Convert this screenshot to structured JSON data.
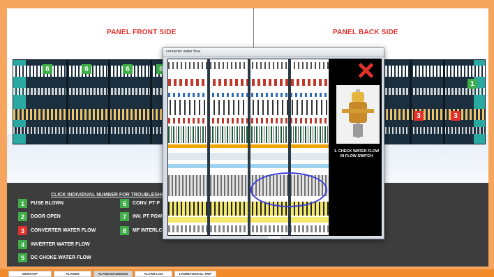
{
  "panel": {
    "front_title": "PANEL FRONT SIDE",
    "back_title": "PANEL BACK SIDE",
    "front_tags": [
      "6",
      "6",
      "6",
      "6"
    ],
    "back_tags_green": [
      "1"
    ],
    "back_tags_red": [
      "3",
      "3"
    ]
  },
  "instructions": "CLICK INDIVIDUAL NUMBER FOR TROUBLESHO",
  "alarms": [
    {
      "num": "1",
      "label": "FUSE BLOWN",
      "status": "green"
    },
    {
      "num": "2",
      "label": "DOOR OPEN",
      "status": "green"
    },
    {
      "num": "3",
      "label": "CONVERTER WATER FLOW",
      "status": "red"
    },
    {
      "num": "4",
      "label": "INVERTER WATER FLOW",
      "status": "green"
    },
    {
      "num": "5",
      "label": "DC CHOKE WATER FLOW",
      "status": "green"
    },
    {
      "num": "6",
      "label": "CONV. PT P",
      "status": "green"
    },
    {
      "num": "7",
      "label": "INV. PT POW",
      "status": "green"
    },
    {
      "num": "8",
      "label": "MF INTERLC",
      "status": "green"
    }
  ],
  "popup": {
    "title": "converter water flow",
    "step": "1. CHECK WATER FLOW IN FLOW SWITCH"
  },
  "tabs": [
    {
      "label": "DESKTOP",
      "active": false
    },
    {
      "label": "ALARMS",
      "active": false
    },
    {
      "label": "ALARM DIAGNOSIS",
      "active": true
    },
    {
      "label": "ALARM LOG",
      "active": false
    },
    {
      "label": "LAMINATION EL TRIP",
      "active": false
    }
  ],
  "colors": {
    "status_green": "#3fae49",
    "status_red": "#e0312b",
    "title_red": "#e0312b",
    "tab_bar": "#f08a2a",
    "background": "#f6a55f"
  }
}
